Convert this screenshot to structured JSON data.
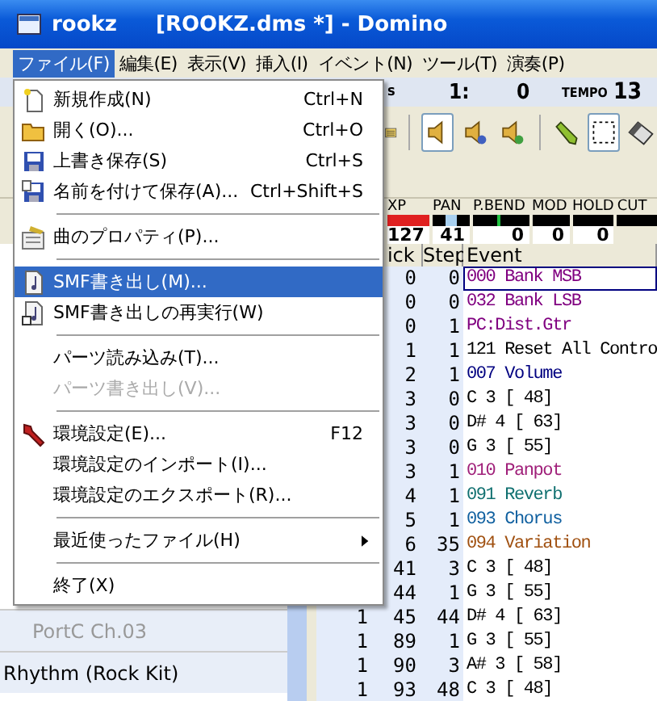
{
  "window": {
    "title_prefix": "rookz",
    "title": "[ROOKZ.dms *] - Domino"
  },
  "menubar": [
    {
      "label": "ファイル(F)",
      "selected": true
    },
    {
      "label": "編集(E)",
      "selected": false
    },
    {
      "label": "表示(V)",
      "selected": false
    },
    {
      "label": "挿入(I)",
      "selected": false
    },
    {
      "label": "イベント(N)",
      "selected": false
    },
    {
      "label": "ツール(T)",
      "selected": false
    },
    {
      "label": "演奏(P)",
      "selected": false
    }
  ],
  "file_menu": [
    {
      "kind": "item",
      "label": "新規作成(N)",
      "shortcut": "Ctrl+N",
      "selected": false,
      "disabled": false
    },
    {
      "kind": "item",
      "label": "開く(O)...",
      "shortcut": "Ctrl+O",
      "selected": false,
      "disabled": false
    },
    {
      "kind": "item",
      "label": "上書き保存(S)",
      "shortcut": "Ctrl+S",
      "selected": false,
      "disabled": false
    },
    {
      "kind": "item",
      "label": "名前を付けて保存(A)...",
      "shortcut": "Ctrl+Shift+S",
      "selected": false,
      "disabled": false
    },
    {
      "kind": "separator"
    },
    {
      "kind": "item",
      "label": "曲のプロパティ(P)...",
      "selected": false,
      "disabled": false
    },
    {
      "kind": "separator"
    },
    {
      "kind": "item",
      "label": "SMF書き出し(M)...",
      "selected": true,
      "disabled": false
    },
    {
      "kind": "item",
      "label": "SMF書き出しの再実行(W)",
      "selected": false,
      "disabled": false
    },
    {
      "kind": "separator"
    },
    {
      "kind": "item",
      "label": "パーツ読み込み(T)...",
      "selected": false,
      "disabled": false
    },
    {
      "kind": "item",
      "label": "パーツ書き出し(V)...",
      "selected": false,
      "disabled": true
    },
    {
      "kind": "separator"
    },
    {
      "kind": "item",
      "label": "環境設定(E)...",
      "shortcut": "F12",
      "selected": false,
      "disabled": false
    },
    {
      "kind": "item",
      "label": "環境設定のインポート(I)...",
      "selected": false,
      "disabled": false
    },
    {
      "kind": "item",
      "label": "環境設定のエクスポート(R)...",
      "selected": false,
      "disabled": false
    },
    {
      "kind": "separator"
    },
    {
      "kind": "item",
      "label": "最近使ったファイル(H)",
      "selected": false,
      "disabled": false,
      "submenu": true
    },
    {
      "kind": "separator"
    },
    {
      "kind": "item",
      "label": "終了(X)",
      "selected": false,
      "disabled": false
    }
  ],
  "position": {
    "suffix": "s",
    "measure": "1:",
    "tick": "0",
    "tempo_label": "TEMPO",
    "tempo": "13"
  },
  "toolbar": [
    {
      "kind": "speaker",
      "selected": true
    },
    {
      "kind": "speaker-s",
      "selected": false
    },
    {
      "kind": "speaker-a",
      "selected": false
    },
    {
      "kind": "pencil",
      "selected": false
    },
    {
      "kind": "select",
      "selected": true
    },
    {
      "kind": "eraser",
      "selected": false
    }
  ],
  "gauges": [
    {
      "label": "XP",
      "value": "127",
      "level": 1,
      "color": "#e02020"
    },
    {
      "label": "PAN",
      "value": "41",
      "level": 0.65,
      "color": "#a8d0f0"
    },
    {
      "label": "P.BEND",
      "value": "0",
      "level": 0.5,
      "color": "#20c040"
    },
    {
      "label": "MOD",
      "value": "0"
    },
    {
      "label": "HOLD",
      "value": "0"
    },
    {
      "label": "CUT"
    }
  ],
  "tracks": [
    {
      "name": "PortC  Ch.03",
      "disabled": true
    },
    {
      "name": "Rhythm (Rock Kit)",
      "disabled": false
    }
  ],
  "event_table": {
    "columns": [
      "ick",
      "Step",
      "Event"
    ],
    "rows": [
      {
        "tick": "0",
        "step": "0",
        "event": "000 Bank MSB",
        "color": "#800080",
        "selected": true
      },
      {
        "tick": "0",
        "step": "0",
        "event": "032 Bank LSB",
        "color": "#800080",
        "selected": false
      },
      {
        "tick": "0",
        "step": "1",
        "event": "PC:Dist.Gtr",
        "color": "#800080",
        "selected": false
      },
      {
        "tick": "1",
        "step": "1",
        "event": "121 Reset All Contro",
        "color": "#000000",
        "selected": false
      },
      {
        "tick": "2",
        "step": "1",
        "event": "007 Volume",
        "color": "#000080",
        "selected": false
      },
      {
        "tick": "3",
        "step": "0",
        "event": "C  3 [ 48]",
        "color": "#000000",
        "selected": false
      },
      {
        "tick": "3",
        "step": "0",
        "event": "D# 4 [ 63]",
        "color": "#000000",
        "selected": false
      },
      {
        "tick": "3",
        "step": "0",
        "event": "G  3 [ 55]",
        "color": "#000000",
        "selected": false
      },
      {
        "tick": "3",
        "step": "1",
        "event": "010 Panpot",
        "color": "#a0207a",
        "selected": false
      },
      {
        "tick": "4",
        "step": "1",
        "event": "091 Reverb",
        "color": "#107070",
        "selected": false
      },
      {
        "tick": "5",
        "step": "1",
        "event": "093 Chorus",
        "color": "#1060a0",
        "selected": false
      },
      {
        "tick": "6",
        "step": "35",
        "event": "094 Variation",
        "color": "#a05010",
        "selected": false
      },
      {
        "tick": "41",
        "step": "3",
        "event": "C  3 [ 48]",
        "color": "#000000",
        "selected": false
      },
      {
        "tick": "44",
        "step": "1",
        "event": "G  3 [ 55]",
        "color": "#000000",
        "selected": false
      },
      {
        "measure": "1",
        "tick": "45",
        "step": "44",
        "event": "D# 4 [ 63]",
        "color": "#000000",
        "selected": false
      },
      {
        "measure": "1",
        "tick": "89",
        "step": "1",
        "event": "G  3 [ 55]",
        "color": "#000000",
        "selected": false
      },
      {
        "measure": "1",
        "tick": "90",
        "step": "3",
        "event": "A# 3 [ 58]",
        "color": "#000000",
        "selected": false
      },
      {
        "measure": "1",
        "tick": "93",
        "step": "48",
        "event": "C  3 [ 48]",
        "color": "#000000",
        "selected": false
      }
    ]
  }
}
